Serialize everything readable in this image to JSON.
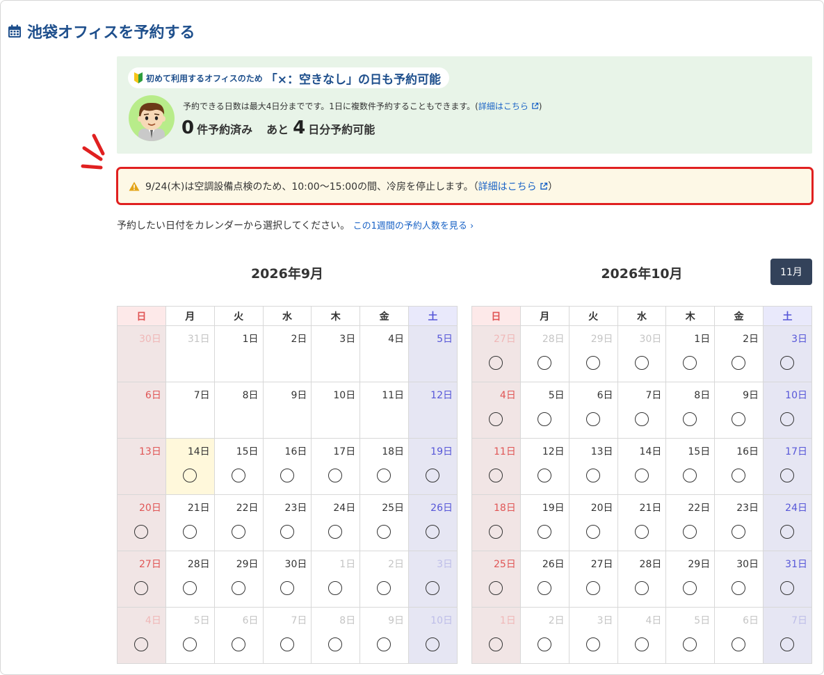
{
  "page": {
    "title": "池袋オフィスを予約する"
  },
  "info": {
    "pill_small": "初めて利用するオフィスのため",
    "pill_big": "「×：空きなし」の日も予約可能",
    "description": "予約できる日数は最大4日分までです。1日に複数件予約することもできます。(",
    "description_link": "詳細はこちら",
    "description_close": ")",
    "booked_count": "0",
    "booked_label": "件予約済み",
    "remaining_prefix": "あと",
    "remaining_count": "4",
    "remaining_label": "日分予約可能"
  },
  "notice": {
    "text": "9/24(木)は空調設備点検のため、10:00〜15:00の間、冷房を停止します。（",
    "link": "詳細はこちら",
    "close": "）"
  },
  "instruction": {
    "text": "予約したい日付をカレンダーから選択してください。",
    "link": "この1週間の予約人数を見る ›"
  },
  "next_month_button": "11月",
  "weekdays": [
    "日",
    "月",
    "火",
    "水",
    "木",
    "金",
    "土"
  ],
  "colors": {
    "accent": "#1e4f8c",
    "link": "#1a63c6",
    "alert_border": "#e02020",
    "info_bg": "#e8f4e8",
    "notice_bg": "#fdf8e6",
    "sunday": "#e05555",
    "saturday": "#5656d8"
  },
  "calendars": [
    {
      "title": "2026年9月",
      "weeks": [
        [
          {
            "label": "30日",
            "dim": true,
            "mark": false
          },
          {
            "label": "31日",
            "dim": true,
            "mark": false
          },
          {
            "label": "1日",
            "mark": false
          },
          {
            "label": "2日",
            "mark": false
          },
          {
            "label": "3日",
            "mark": false
          },
          {
            "label": "4日",
            "mark": false
          },
          {
            "label": "5日",
            "mark": false
          }
        ],
        [
          {
            "label": "6日",
            "mark": false
          },
          {
            "label": "7日",
            "mark": false
          },
          {
            "label": "8日",
            "mark": false
          },
          {
            "label": "9日",
            "mark": false
          },
          {
            "label": "10日",
            "mark": false
          },
          {
            "label": "11日",
            "mark": false
          },
          {
            "label": "12日",
            "mark": false
          }
        ],
        [
          {
            "label": "13日",
            "mark": false
          },
          {
            "label": "14日",
            "mark": true,
            "today": true
          },
          {
            "label": "15日",
            "mark": true
          },
          {
            "label": "16日",
            "mark": true
          },
          {
            "label": "17日",
            "mark": true
          },
          {
            "label": "18日",
            "mark": true
          },
          {
            "label": "19日",
            "mark": true
          }
        ],
        [
          {
            "label": "20日",
            "mark": true
          },
          {
            "label": "21日",
            "mark": true
          },
          {
            "label": "22日",
            "mark": true
          },
          {
            "label": "23日",
            "mark": true
          },
          {
            "label": "24日",
            "mark": true
          },
          {
            "label": "25日",
            "mark": true
          },
          {
            "label": "26日",
            "mark": true
          }
        ],
        [
          {
            "label": "27日",
            "mark": true
          },
          {
            "label": "28日",
            "mark": true
          },
          {
            "label": "29日",
            "mark": true
          },
          {
            "label": "30日",
            "mark": true
          },
          {
            "label": "1日",
            "dim": true,
            "mark": true
          },
          {
            "label": "2日",
            "dim": true,
            "mark": true
          },
          {
            "label": "3日",
            "dim": true,
            "mark": true
          }
        ],
        [
          {
            "label": "4日",
            "dim": true,
            "mark": true
          },
          {
            "label": "5日",
            "dim": true,
            "mark": true
          },
          {
            "label": "6日",
            "dim": true,
            "mark": true
          },
          {
            "label": "7日",
            "dim": true,
            "mark": true
          },
          {
            "label": "8日",
            "dim": true,
            "mark": true
          },
          {
            "label": "9日",
            "dim": true,
            "mark": true
          },
          {
            "label": "10日",
            "dim": true,
            "mark": true
          }
        ]
      ]
    },
    {
      "title": "2026年10月",
      "weeks": [
        [
          {
            "label": "27日",
            "dim": true,
            "mark": true
          },
          {
            "label": "28日",
            "dim": true,
            "mark": true
          },
          {
            "label": "29日",
            "dim": true,
            "mark": true
          },
          {
            "label": "30日",
            "dim": true,
            "mark": true
          },
          {
            "label": "1日",
            "mark": true
          },
          {
            "label": "2日",
            "mark": true
          },
          {
            "label": "3日",
            "mark": true
          }
        ],
        [
          {
            "label": "4日",
            "mark": true
          },
          {
            "label": "5日",
            "mark": true
          },
          {
            "label": "6日",
            "mark": true
          },
          {
            "label": "7日",
            "mark": true
          },
          {
            "label": "8日",
            "mark": true
          },
          {
            "label": "9日",
            "mark": true
          },
          {
            "label": "10日",
            "mark": true
          }
        ],
        [
          {
            "label": "11日",
            "mark": true
          },
          {
            "label": "12日",
            "mark": true
          },
          {
            "label": "13日",
            "mark": true
          },
          {
            "label": "14日",
            "mark": true
          },
          {
            "label": "15日",
            "mark": true
          },
          {
            "label": "16日",
            "mark": true
          },
          {
            "label": "17日",
            "mark": true
          }
        ],
        [
          {
            "label": "18日",
            "mark": true
          },
          {
            "label": "19日",
            "mark": true
          },
          {
            "label": "20日",
            "mark": true
          },
          {
            "label": "21日",
            "mark": true
          },
          {
            "label": "22日",
            "mark": true
          },
          {
            "label": "23日",
            "mark": true
          },
          {
            "label": "24日",
            "mark": true
          }
        ],
        [
          {
            "label": "25日",
            "mark": true
          },
          {
            "label": "26日",
            "mark": true
          },
          {
            "label": "27日",
            "mark": true
          },
          {
            "label": "28日",
            "mark": true
          },
          {
            "label": "29日",
            "mark": true
          },
          {
            "label": "30日",
            "mark": true
          },
          {
            "label": "31日",
            "mark": true
          }
        ],
        [
          {
            "label": "1日",
            "dim": true,
            "mark": true
          },
          {
            "label": "2日",
            "dim": true,
            "mark": true
          },
          {
            "label": "3日",
            "dim": true,
            "mark": true
          },
          {
            "label": "4日",
            "dim": true,
            "mark": true
          },
          {
            "label": "5日",
            "dim": true,
            "mark": true
          },
          {
            "label": "6日",
            "dim": true,
            "mark": true
          },
          {
            "label": "7日",
            "dim": true,
            "mark": true
          }
        ]
      ]
    }
  ]
}
